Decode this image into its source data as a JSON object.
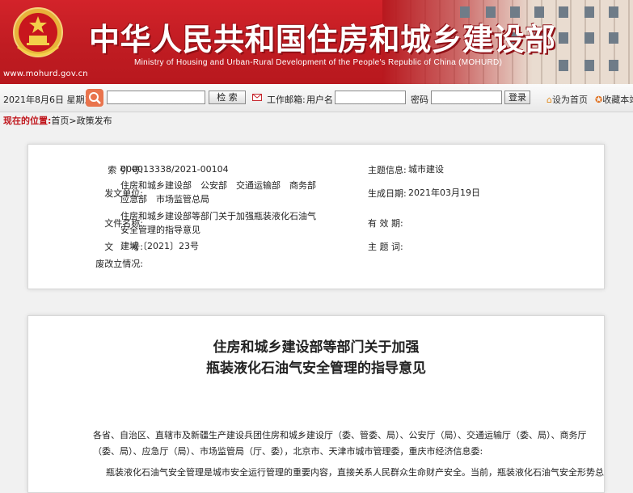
{
  "header": {
    "title_cn": "中华人民共和国住房和城乡建设部",
    "title_en": "Ministry of Housing and Urban-Rural Development of the People's Republic of China (MOHURD)",
    "url": "www.mohurd.gov.cn",
    "colors": {
      "brand_red": "#c01c22"
    }
  },
  "toolbar": {
    "date": "2021年8月6日 星期五",
    "search_button": "检  索",
    "mail_label": "工作邮箱:",
    "username_label": "用户名",
    "password_label": "密码",
    "login_button": "登录",
    "set_home": "设为首页",
    "bookmark": "收藏本站",
    "icons": [
      "search-icon",
      "mail-icon",
      "home-icon",
      "bookmark-icon"
    ]
  },
  "breadcrumb": {
    "label": "现在的位置:",
    "path": "首页>政策发布"
  },
  "info": {
    "index_label": "索  引  号:",
    "index_value": "000013338/2021-00104",
    "subject_label": "主题信息:",
    "subject_value": "城市建设",
    "issuer_label": "发文单位:",
    "issuer_value": "住房和城乡建设部　公安部　交通运输部　商务部　应急部　市场监管总局",
    "date_label": "生成日期:",
    "date_value": "2021年03月19日",
    "filename_label": "文件名称:",
    "filename_value": "住房和城乡建设部等部门关于加强瓶装液化石油气安全管理的指导意见",
    "validity_label": "有  效  期:",
    "validity_value": "",
    "docno_label": "文　　号:",
    "docno_value": "建城〔2021〕23号",
    "keyword_label": "主  题  词:",
    "keyword_value": "",
    "abolish_label": "废改立情况:",
    "abolish_value": ""
  },
  "article": {
    "title_line1": "住房和城乡建设部等部门关于加强",
    "title_line2": "瓶装液化石油气安全管理的指导意见",
    "addressee_line1": "各省、自治区、直辖市及新疆生产建设兵团住房和城乡建设厅（委、管委、局）、公安厅（局）、交通运输厅（委、局）、商务厅",
    "addressee_line2": "（委、局）、应急厅（局）、市场监管局（厅、委），北京市、天津市城市管理委，重庆市经济信息委:",
    "body_line1": "瓶装液化石油气安全管理是城市安全运行管理的重要内容，直接关系人民群众生命财产安全。当前，瓶装液化石油气安全形势总"
  }
}
